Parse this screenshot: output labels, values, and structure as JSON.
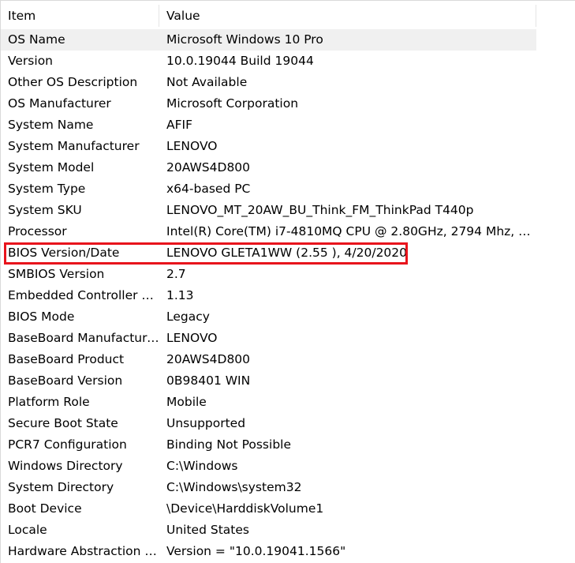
{
  "columns": {
    "item": "Item",
    "value": "Value"
  },
  "rows": [
    {
      "item": "OS Name",
      "value": "Microsoft Windows 10 Pro",
      "selected": true
    },
    {
      "item": "Version",
      "value": "10.0.19044 Build 19044"
    },
    {
      "item": "Other OS Description",
      "value": "Not Available"
    },
    {
      "item": "OS Manufacturer",
      "value": "Microsoft Corporation"
    },
    {
      "item": "System Name",
      "value": "AFIF"
    },
    {
      "item": "System Manufacturer",
      "value": "LENOVO"
    },
    {
      "item": "System Model",
      "value": "20AWS4D800"
    },
    {
      "item": "System Type",
      "value": "x64-based PC"
    },
    {
      "item": "System SKU",
      "value": "LENOVO_MT_20AW_BU_Think_FM_ThinkPad T440p"
    },
    {
      "item": "Processor",
      "value": "Intel(R) Core(TM) i7-4810MQ CPU @ 2.80GHz, 2794 Mhz, 4 ..."
    },
    {
      "item": "BIOS Version/Date",
      "value": "LENOVO GLETA1WW (2.55 ), 4/20/2020",
      "highlighted": true
    },
    {
      "item": "SMBIOS Version",
      "value": "2.7"
    },
    {
      "item": "Embedded Controller V...",
      "value": "1.13"
    },
    {
      "item": "BIOS Mode",
      "value": "Legacy"
    },
    {
      "item": "BaseBoard Manufacturer",
      "value": "LENOVO"
    },
    {
      "item": "BaseBoard Product",
      "value": "20AWS4D800"
    },
    {
      "item": "BaseBoard Version",
      "value": "0B98401 WIN"
    },
    {
      "item": "Platform Role",
      "value": "Mobile"
    },
    {
      "item": "Secure Boot State",
      "value": "Unsupported"
    },
    {
      "item": "PCR7 Configuration",
      "value": "Binding Not Possible"
    },
    {
      "item": "Windows Directory",
      "value": "C:\\Windows"
    },
    {
      "item": "System Directory",
      "value": "C:\\Windows\\system32"
    },
    {
      "item": "Boot Device",
      "value": "\\Device\\HarddiskVolume1"
    },
    {
      "item": "Locale",
      "value": "United States"
    },
    {
      "item": "Hardware Abstraction L...",
      "value": "Version = \"10.0.19041.1566\""
    }
  ],
  "colors": {
    "highlight_border": "#e8141c",
    "selected_row": "#f0f0f0"
  }
}
